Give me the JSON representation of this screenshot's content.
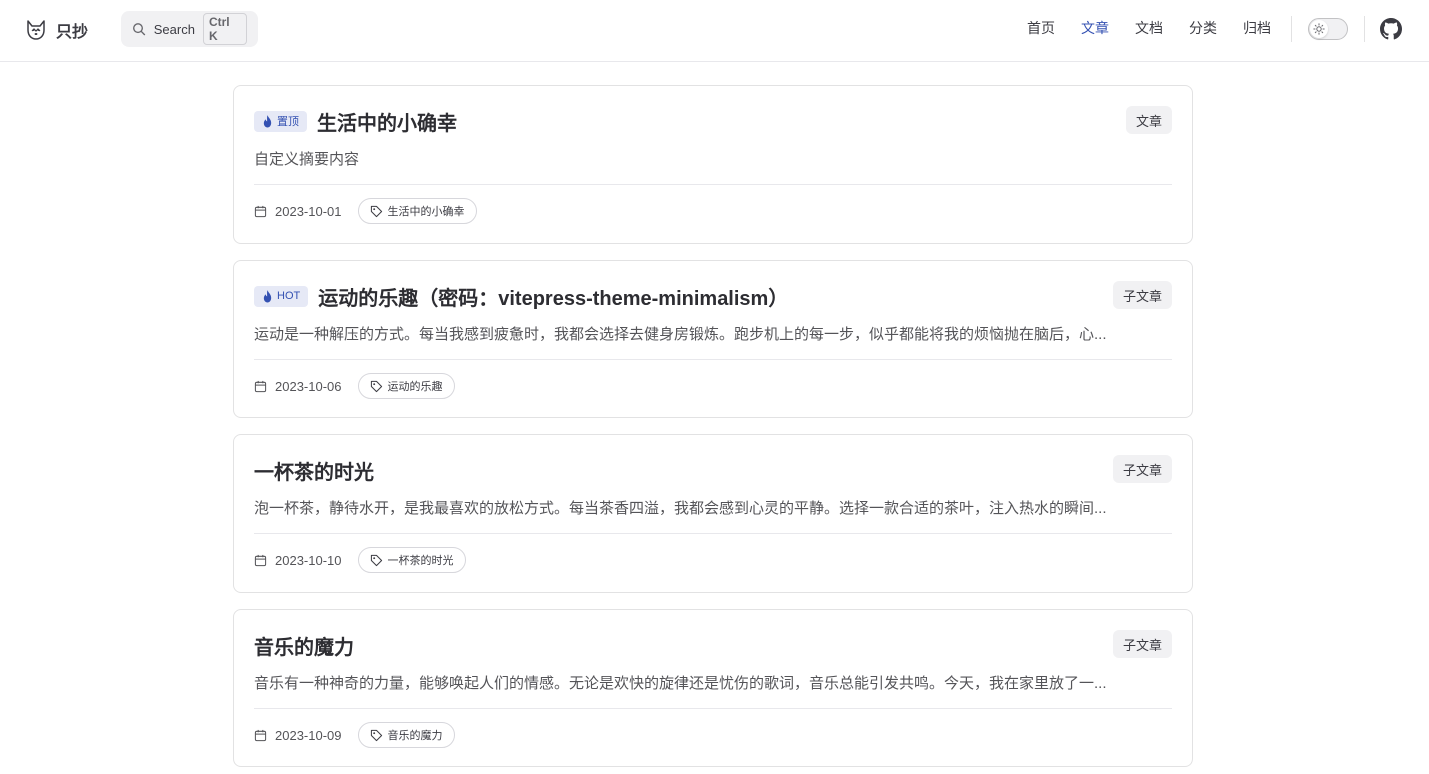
{
  "brand": {
    "title": "只抄",
    "logo_icon": "husky-logo-icon"
  },
  "search": {
    "label": "Search",
    "shortcut": "Ctrl K"
  },
  "nav": {
    "items": [
      {
        "label": "首页",
        "active": false
      },
      {
        "label": "文章",
        "active": true
      },
      {
        "label": "文档",
        "active": false
      },
      {
        "label": "分类",
        "active": false
      },
      {
        "label": "归档",
        "active": false
      }
    ]
  },
  "theme": {
    "accent": "#3451b2",
    "badge_bg": "#e6e9f6"
  },
  "posts": [
    {
      "badge": "置顶",
      "title": "生活中的小确幸",
      "category": "文章",
      "excerpt": "自定义摘要内容",
      "date": "2023-10-01",
      "tag": "生活中的小确幸"
    },
    {
      "badge": "HOT",
      "title": "运动的乐趣（密码：vitepress-theme-minimalism）",
      "category": "子文章",
      "excerpt": "运动是一种解压的方式。每当我感到疲惫时，我都会选择去健身房锻炼。跑步机上的每一步，似乎都能将我的烦恼抛在脑后，心...",
      "date": "2023-10-06",
      "tag": "运动的乐趣"
    },
    {
      "badge": "",
      "title": "一杯茶的时光",
      "category": "子文章",
      "excerpt": "泡一杯茶，静待水开，是我最喜欢的放松方式。每当茶香四溢，我都会感到心灵的平静。选择一款合适的茶叶，注入热水的瞬间...",
      "date": "2023-10-10",
      "tag": "一杯茶的时光"
    },
    {
      "badge": "",
      "title": "音乐的魔力",
      "category": "子文章",
      "excerpt": "音乐有一种神奇的力量，能够唤起人们的情感。无论是欢快的旋律还是忧伤的歌词，音乐总能引发共鸣。今天，我在家里放了一...",
      "date": "2023-10-09",
      "tag": "音乐的魔力"
    }
  ]
}
